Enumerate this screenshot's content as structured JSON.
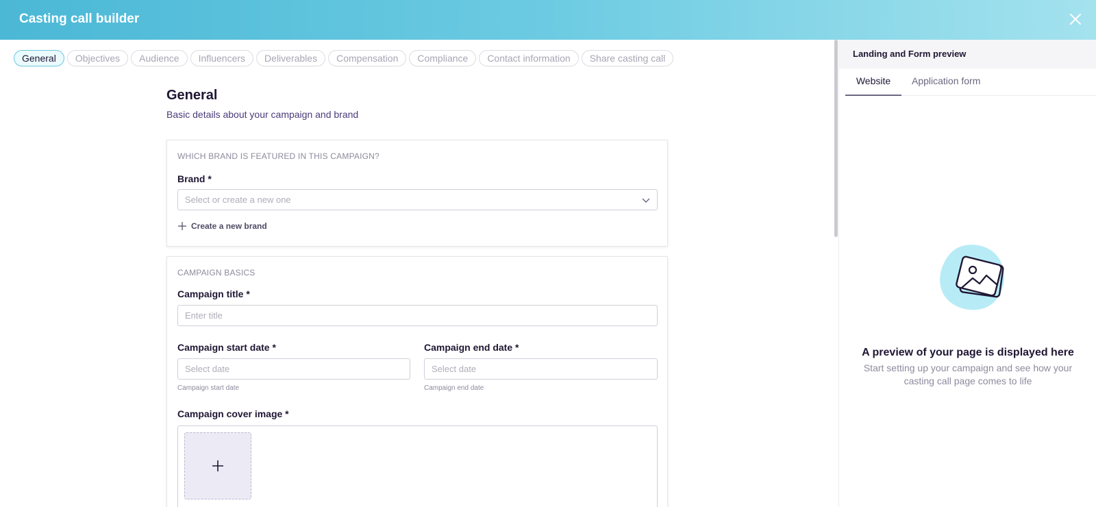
{
  "header": {
    "title": "Casting call builder"
  },
  "tabs": [
    "General",
    "Objectives",
    "Audience",
    "Influencers",
    "Deliverables",
    "Compensation",
    "Compliance",
    "Contact information",
    "Share casting call"
  ],
  "general": {
    "title": "General",
    "subtitle": "Basic details about your campaign and brand"
  },
  "brand_section": {
    "heading": "WHICH BRAND IS FEATURED IN THIS CAMPAIGN?",
    "brand_label": "Brand *",
    "brand_placeholder": "Select or create a new one",
    "create_label": "Create a new brand"
  },
  "basics_section": {
    "heading": "CAMPAIGN BASICS",
    "title_label": "Campaign title *",
    "title_placeholder": "Enter title",
    "start_label": "Campaign start date *",
    "start_placeholder": "Select date",
    "start_hint": "Campaign start date",
    "end_label": "Campaign end date *",
    "end_placeholder": "Select date",
    "end_hint": "Campaign end date",
    "cover_label": "Campaign cover image *"
  },
  "preview": {
    "heading": "Landing and Form preview",
    "tabs": [
      "Website",
      "Application form"
    ],
    "title": "A preview of your page is displayed here",
    "text": "Start setting up your campaign and see how your casting call page comes to life"
  },
  "colors": {
    "accent": "#6cc7dd",
    "header_start": "#4bb8d6",
    "header_end": "#a4e2ee"
  }
}
